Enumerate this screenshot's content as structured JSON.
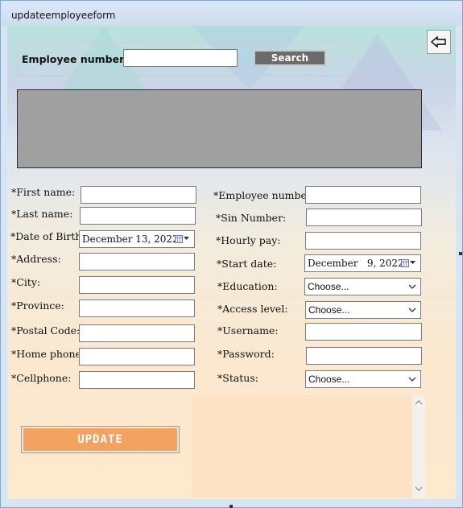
{
  "window": {
    "title": "updateemployeeform"
  },
  "search": {
    "label": "Employee number:",
    "value": "",
    "button_label": "Search"
  },
  "left_form": {
    "first_name_label": "*First name:",
    "last_name_label": "*Last name:",
    "dob_label": "*Date of Birth:",
    "dob_value": "December 13, 2022",
    "address_label": "*Address:",
    "city_label": "*City:",
    "province_label": "*Province:",
    "postal_label": "*Postal Code:",
    "home_phone_label": "*Home phone:",
    "cellphone_label": "*Cellphone:"
  },
  "right_form": {
    "employee_number_label": "*Employee number:",
    "sin_label": "*Sin Number:",
    "hourly_label": "*Hourly pay:",
    "start_date_label": "*Start date:",
    "start_date_value": "December   9, 2022",
    "education_label": "*Education:",
    "education_value": "Choose...",
    "access_label": "*Access level:",
    "access_value": "Choose...",
    "username_label": "*Username:",
    "password_label": "*Password:",
    "status_label": "*Status:",
    "status_value": "Choose..."
  },
  "update_button_label": "UPDATE",
  "icons": {
    "back": "back-arrow-icon",
    "calendar": "calendar-icon",
    "dropdown": "chevron-down-icon"
  },
  "colors": {
    "accent": "#f4a25f",
    "grid": "#a0a0a0",
    "search_button": "#6b6b6b",
    "notes_bg": "#fde3c4"
  }
}
